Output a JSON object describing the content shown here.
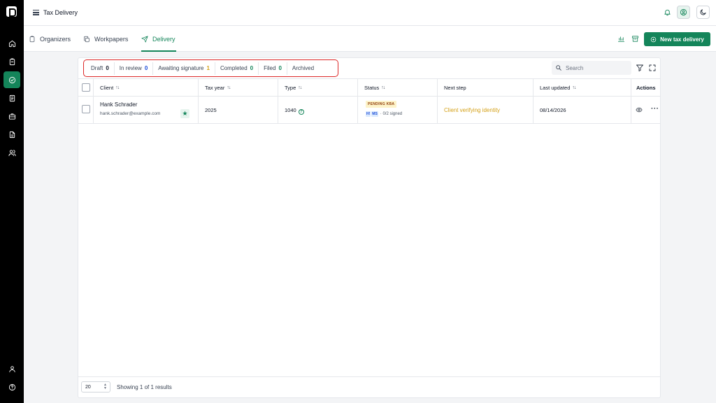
{
  "app": {
    "title": "Tax Delivery"
  },
  "sidebar": {
    "items": [
      {
        "icon": "home-icon"
      },
      {
        "icon": "clipboard-icon"
      },
      {
        "icon": "delivery-icon",
        "active": true
      },
      {
        "icon": "document-icon"
      },
      {
        "icon": "briefcase-icon"
      },
      {
        "icon": "file-icon"
      },
      {
        "icon": "users-icon"
      }
    ],
    "bottom": [
      {
        "icon": "user-icon"
      },
      {
        "icon": "help-icon"
      }
    ]
  },
  "nav": {
    "tabs": [
      {
        "label": "Organizers",
        "icon": "clipboard-icon"
      },
      {
        "label": "Workpapers",
        "icon": "copy-icon"
      },
      {
        "label": "Delivery",
        "icon": "send-icon",
        "active": true
      }
    ],
    "new_button": "New tax delivery"
  },
  "filters": [
    {
      "label": "Draft",
      "count": "0",
      "color": "#111827"
    },
    {
      "label": "In review",
      "count": "0",
      "color": "#1d4ed8"
    },
    {
      "label": "Awaiting signature",
      "count": "1",
      "color": "#d4a017"
    },
    {
      "label": "Completed",
      "count": "0",
      "color": "#14855a"
    },
    {
      "label": "Filed",
      "count": "0",
      "color": "#14855a"
    },
    {
      "label": "Archived",
      "count": ""
    }
  ],
  "search": {
    "placeholder": "Search"
  },
  "table": {
    "headers": {
      "client": "Client",
      "tax_year": "Tax year",
      "type": "Type",
      "status": "Status",
      "next_step": "Next step",
      "last_updated": "Last updated",
      "actions": "Actions"
    },
    "rows": [
      {
        "client_name": "Hank Schrader",
        "client_email": "hank.schrader@example.com",
        "tax_year": "2025",
        "type": "1040",
        "status_badge": "PENDING KBA",
        "signer_1": "H!",
        "signer_2": "MS",
        "signed": "· 0/2 signed",
        "next_step": "Client verifying identity",
        "last_updated": "08/14/2026"
      }
    ]
  },
  "footer": {
    "page_size": "20",
    "results": "Showing 1 of 1 results"
  },
  "colors": {
    "accent": "#14855a",
    "warning": "#d4a017",
    "highlight": "#dc2626"
  }
}
